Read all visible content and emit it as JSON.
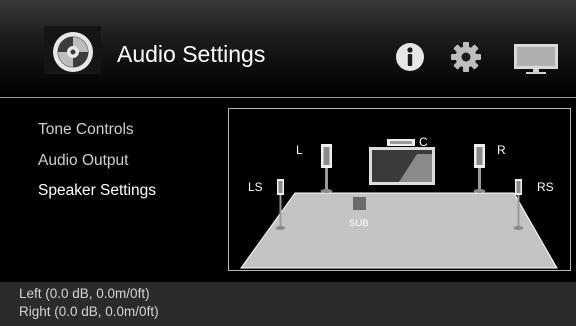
{
  "header": {
    "title": "Audio Settings",
    "icons": [
      "audio-disc-icon",
      "info-icon",
      "gear-icon",
      "display-icon"
    ]
  },
  "menu": {
    "items": [
      {
        "label": "Tone Controls",
        "active": false
      },
      {
        "label": "Audio Output",
        "active": false
      },
      {
        "label": "Speaker Settings",
        "active": true
      }
    ]
  },
  "speakers": {
    "labels": {
      "front_left": "L",
      "center": "C",
      "front_right": "R",
      "surround_left": "LS",
      "surround_right": "RS",
      "subwoofer": "SUB"
    }
  },
  "status": {
    "line1": "Left (0.0 dB, 0.0m/0ft)",
    "line2": "Right (0.0 dB, 0.0m/0ft)"
  },
  "colors": {
    "background": "#000000",
    "status_bar": "#2b2b2b",
    "text": "#ffffff"
  }
}
